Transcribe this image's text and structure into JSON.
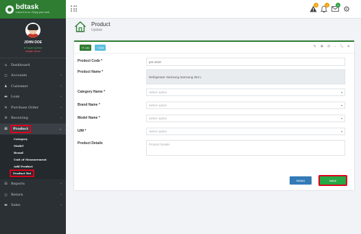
{
  "brand": {
    "name": "bdtask",
    "tagline": "Leave it to us • Enjoy your work"
  },
  "user": {
    "name": "JOHN DOE",
    "status": "● Super Admin",
    "role": "Health Store"
  },
  "sidebar": {
    "items": [
      {
        "label": "Dashboard",
        "icon": "⌂",
        "chevron": ""
      },
      {
        "label": "Accounts",
        "icon": "◻",
        "chevron": "‹"
      },
      {
        "label": "Customer",
        "icon": "♟",
        "chevron": "‹"
      },
      {
        "label": "Loan",
        "icon": "▬",
        "chevron": "‹"
      },
      {
        "label": "Purchase Order",
        "icon": "≡",
        "chevron": "‹"
      },
      {
        "label": "Receiving",
        "icon": "⊘",
        "chevron": "‹"
      },
      {
        "label": "Product",
        "icon": "⊟",
        "chevron": "⌄"
      }
    ],
    "submenu": [
      "Category",
      "Model",
      "Brand",
      "Unit of Measurement",
      "Add Product",
      "Product list"
    ],
    "bottom_items": [
      {
        "label": "Reports",
        "icon": "⊟",
        "chevron": "‹"
      },
      {
        "label": "Return",
        "icon": "◻",
        "chevron": "‹"
      },
      {
        "label": "Sales",
        "icon": "▬",
        "chevron": "‹"
      }
    ]
  },
  "header": {
    "badges": {
      "alert": "3",
      "bell": "1",
      "mail": "0"
    },
    "icons": [
      "grid-icon",
      "alert-icon",
      "bell-icon",
      "mail-icon",
      "gear-icon"
    ]
  },
  "page": {
    "title": "Product",
    "subtitle": "Update"
  },
  "toolbar": {
    "list_label": "☷ List",
    "add_label": "+ Add",
    "tools": [
      "✎",
      "✥",
      "⟳",
      "–",
      "⤡",
      "✕"
    ]
  },
  "form": {
    "product_code": {
      "label": "Product Code *",
      "value": "pm-1010"
    },
    "product_name": {
      "label": "Product Name *",
      "value": "Refrigerator Samsung Samsung 394 L"
    },
    "category": {
      "label": "Category Name *",
      "placeholder": "Select option"
    },
    "brand": {
      "label": "Brand Name *",
      "placeholder": "Select option"
    },
    "model": {
      "label": "Model Name *",
      "placeholder": "Select option"
    },
    "uom": {
      "label": "U/M *",
      "placeholder": "Select option"
    },
    "details": {
      "label": "Product Details",
      "placeholder": "Product Details"
    }
  },
  "actions": {
    "reset_label": "Reset",
    "save_label": "Save"
  },
  "colors": {
    "brand_green": "#2e7d32",
    "sidebar_bg": "#2b3035",
    "reset_blue": "#337ab7",
    "save_green": "#28a745",
    "highlight_red": "#e0001b"
  }
}
